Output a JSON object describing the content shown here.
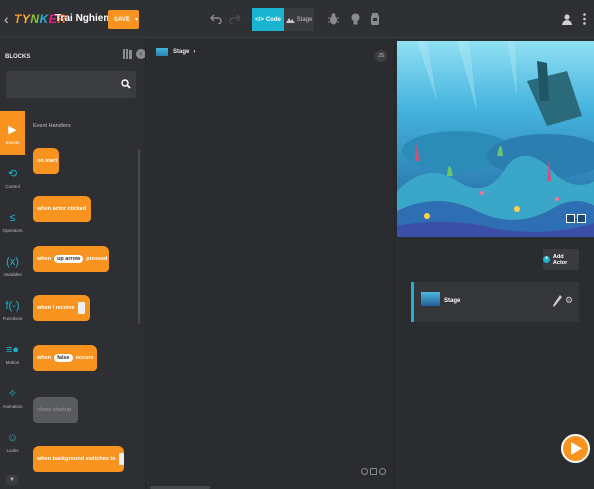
{
  "topbar": {
    "logo_text": "TYNKER",
    "logo_letters": [
      "T",
      "Y",
      "N",
      "K",
      "E",
      "R"
    ],
    "logo_colors": [
      "#f7931e",
      "#fbb03b",
      "#8cc63f",
      "#29abe2",
      "#ed1e79",
      "#f15a24"
    ],
    "project_name": "Trai Nghiem",
    "save_label": "SAVE",
    "code_tab_label": "Code",
    "stage_tab_label": "Stage",
    "icons": [
      "back-arrow-icon",
      "undo-icon",
      "redo-icon",
      "code-icon",
      "stage-icon",
      "bug-icon",
      "hint-icon",
      "jar-icon",
      "user-icon",
      "more-icon"
    ]
  },
  "blocks": {
    "title": "BLOCKS",
    "search_placeholder": "",
    "categories": [
      {
        "label": "Events",
        "icon": "events-icon",
        "glyph": "▶",
        "active": true
      },
      {
        "label": "Control",
        "icon": "control-icon",
        "glyph": "⟲"
      },
      {
        "label": "Operators",
        "icon": "operators-icon",
        "glyph": "≤"
      },
      {
        "label": "Variables",
        "icon": "variables-icon",
        "glyph": "(x)"
      },
      {
        "label": "Functions",
        "icon": "functions-icon",
        "glyph": "f(-)"
      },
      {
        "label": "Motion",
        "icon": "motion-icon",
        "glyph": "≡●"
      },
      {
        "label": "Animation",
        "icon": "animation-icon",
        "glyph": "✧"
      },
      {
        "label": "Looks",
        "icon": "looks-icon",
        "glyph": "☺"
      }
    ],
    "section_header": "Event Handlers",
    "items": [
      {
        "label": "on start"
      },
      {
        "label": "when actor clicked"
      },
      {
        "pre": "when",
        "pill": "up arrow",
        "post": "pressed"
      },
      {
        "label": "when I receive"
      },
      {
        "pre": "when",
        "pill": "false",
        "post": "occurs"
      },
      {
        "label": "clone startup"
      },
      {
        "label": "when background switches to"
      }
    ]
  },
  "code": {
    "breadcrumb": "Stage",
    "js_label": "JS"
  },
  "stage": {
    "add_actor_label": "Add Actor",
    "actor_name": "Stage"
  },
  "colors": {
    "accent": "#f7931e",
    "cyan": "#18b4d0",
    "background": "#2b2c2f"
  }
}
